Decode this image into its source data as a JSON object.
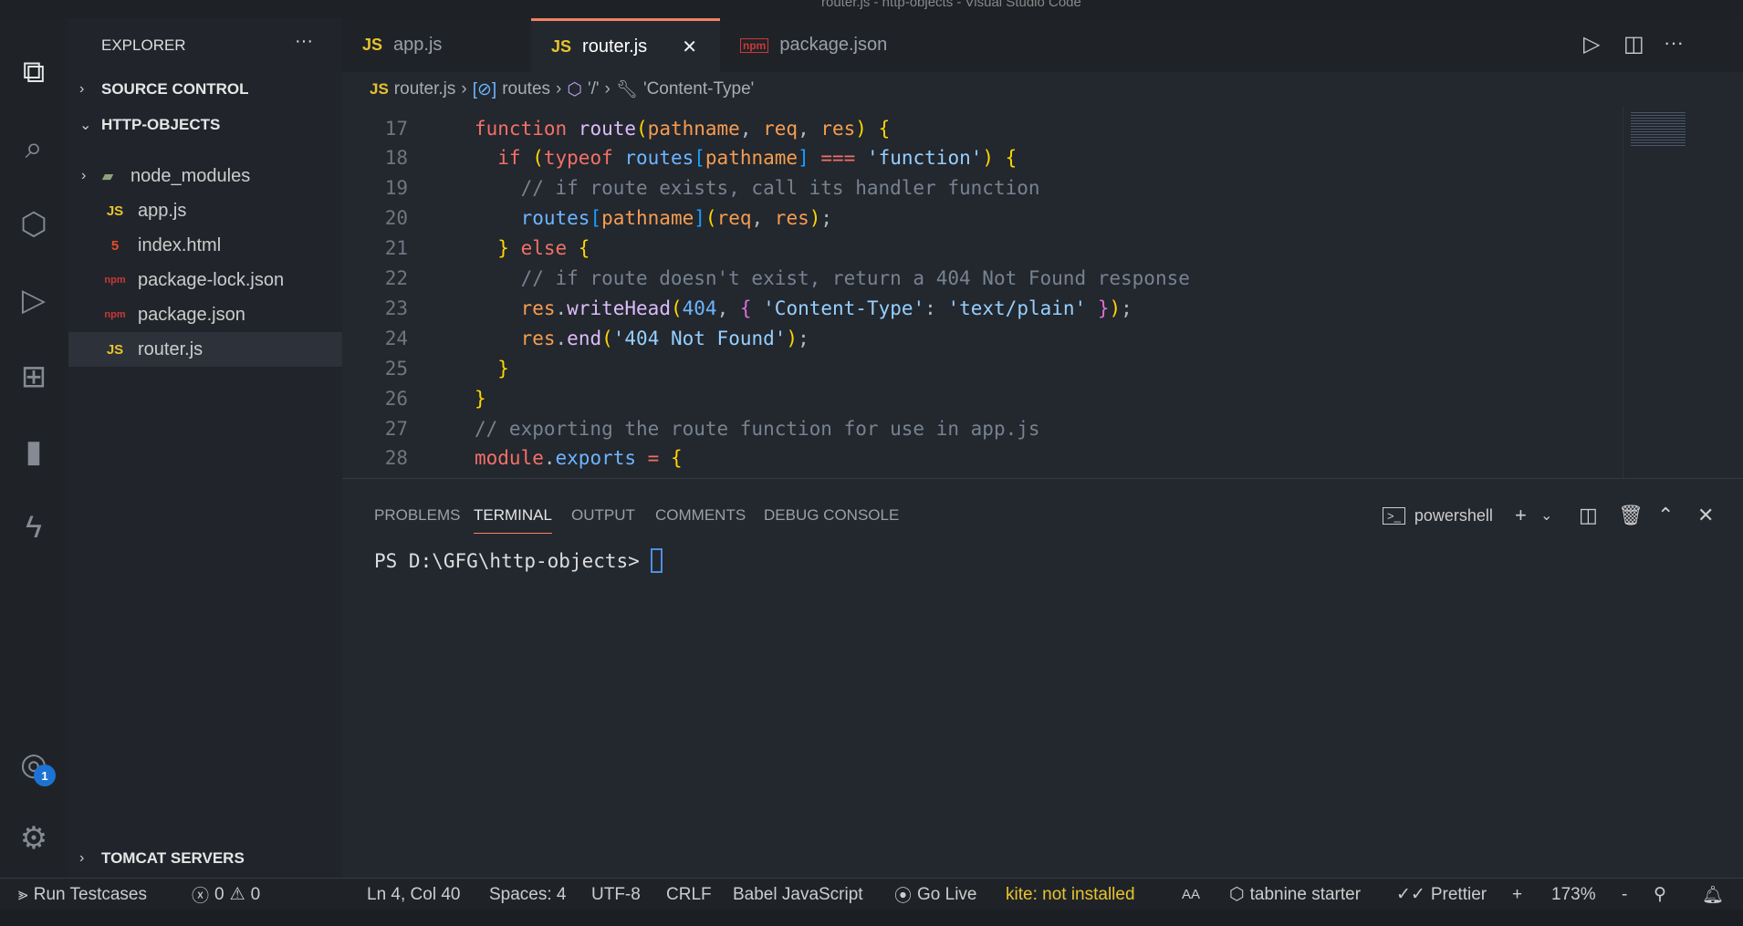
{
  "window": {
    "title": "router.js - http-objects - Visual Studio Code"
  },
  "activity_bar": {
    "items": [
      "files-icon",
      "search-icon",
      "source-control-icon",
      "run-debug-icon",
      "extensions-icon",
      "charts-icon",
      "lightning-icon"
    ],
    "account_badge": "1"
  },
  "sidebar": {
    "header": "EXPLORER",
    "more": "···",
    "sections": {
      "source_control": "SOURCE CONTROL",
      "project": "HTTP-OBJECTS",
      "tomcat": "TOMCAT SERVERS"
    },
    "files": [
      {
        "name": "node_modules",
        "icon": "folder",
        "badge": "",
        "folder": true
      },
      {
        "name": "app.js",
        "icon": "JS"
      },
      {
        "name": "index.html",
        "icon": "5"
      },
      {
        "name": "package-lock.json",
        "icon": "npm"
      },
      {
        "name": "package.json",
        "icon": "npm"
      },
      {
        "name": "router.js",
        "icon": "JS",
        "selected": true
      }
    ]
  },
  "tabs": [
    {
      "label": "app.js",
      "icon": "JS"
    },
    {
      "label": "router.js",
      "icon": "JS",
      "active": true,
      "close": "✕"
    },
    {
      "label": "package.json",
      "icon": "npm"
    }
  ],
  "breadcrumb": {
    "file": "router.js",
    "file_icon": "JS",
    "symbol1": "routes",
    "symbol2": "'/'",
    "symbol3": "'Content-Type'",
    "sep": "›"
  },
  "editor": {
    "lines": [
      {
        "n": "17",
        "t": [
          [
            "function ",
            "kw"
          ],
          [
            "route",
            "fn"
          ],
          [
            "(",
            "b1"
          ],
          [
            "pathname",
            "pa"
          ],
          [
            ", ",
            "pl"
          ],
          [
            "req",
            "pa"
          ],
          [
            ", ",
            "pl"
          ],
          [
            "res",
            "pa"
          ],
          [
            ") ",
            "b1"
          ],
          [
            "{",
            "b1"
          ]
        ]
      },
      {
        "n": "18",
        "t": [
          [
            "  if ",
            "kw"
          ],
          [
            "(",
            "b1"
          ],
          [
            "typeof ",
            "kw"
          ],
          [
            "routes",
            "va"
          ],
          [
            "[",
            "b3"
          ],
          [
            "pathname",
            "pa"
          ],
          [
            "] ",
            "b3"
          ],
          [
            "=== ",
            "kw"
          ],
          [
            "'function'",
            "st"
          ],
          [
            ") ",
            "b1"
          ],
          [
            "{",
            "b1"
          ]
        ]
      },
      {
        "n": "19",
        "t": [
          [
            "    // if route exists, call its handler function",
            "cm"
          ]
        ]
      },
      {
        "n": "20",
        "t": [
          [
            "    routes",
            "va"
          ],
          [
            "[",
            "b3"
          ],
          [
            "pathname",
            "pa"
          ],
          [
            "]",
            "b3"
          ],
          [
            "(",
            "b1"
          ],
          [
            "req",
            "pa"
          ],
          [
            ", ",
            "pl"
          ],
          [
            "res",
            "pa"
          ],
          [
            ")",
            "b1"
          ],
          [
            ";",
            "pl"
          ]
        ]
      },
      {
        "n": "21",
        "t": [
          [
            "  } ",
            "b1"
          ],
          [
            "else ",
            "kw"
          ],
          [
            "{",
            "b1"
          ]
        ]
      },
      {
        "n": "22",
        "t": [
          [
            "    // if route doesn't exist, return a 404 Not Found response",
            "cm"
          ]
        ]
      },
      {
        "n": "23",
        "t": [
          [
            "    res",
            "pa"
          ],
          [
            ".",
            "pl"
          ],
          [
            "writeHead",
            "fn"
          ],
          [
            "(",
            "b1"
          ],
          [
            "404",
            "nu"
          ],
          [
            ", ",
            "pl"
          ],
          [
            "{ ",
            "b2"
          ],
          [
            "'Content-Type'",
            "st"
          ],
          [
            ": ",
            "pl"
          ],
          [
            "'text/plain' ",
            "st"
          ],
          [
            "}",
            "b2"
          ],
          [
            ")",
            "b1"
          ],
          [
            ";",
            "pl"
          ]
        ]
      },
      {
        "n": "24",
        "t": [
          [
            "    res",
            "pa"
          ],
          [
            ".",
            "pl"
          ],
          [
            "end",
            "fn"
          ],
          [
            "(",
            "b1"
          ],
          [
            "'404 Not Found'",
            "st"
          ],
          [
            ")",
            "b1"
          ],
          [
            ";",
            "pl"
          ]
        ]
      },
      {
        "n": "25",
        "t": [
          [
            "  }",
            "b1"
          ]
        ]
      },
      {
        "n": "26",
        "t": [
          [
            "}",
            "b1"
          ]
        ]
      },
      {
        "n": "27",
        "t": [
          [
            "// exporting the route function for use in app.js",
            "cm"
          ]
        ]
      },
      {
        "n": "28",
        "t": [
          [
            "module",
            "kw"
          ],
          [
            ".",
            "pl"
          ],
          [
            "exports ",
            "va"
          ],
          [
            "= ",
            "kw"
          ],
          [
            "{",
            "b1"
          ]
        ]
      }
    ]
  },
  "panel": {
    "tabs": [
      "PROBLEMS",
      "TERMINAL",
      "OUTPUT",
      "COMMENTS",
      "DEBUG CONSOLE"
    ],
    "active_tab": "TERMINAL",
    "shell": "powershell",
    "prompt": "PS D:\\GFG\\http-objects>"
  },
  "status": {
    "run": "Run Testcases",
    "errors": "0",
    "warnings": "0",
    "position": "Ln 4, Col 40",
    "spaces": "Spaces: 4",
    "encoding": "UTF-8",
    "eol": "CRLF",
    "language": "Babel JavaScript",
    "golive": "Go Live",
    "kite": "kite: not installed",
    "aa": "AA",
    "tabnine": "tabnine starter",
    "prettier": "Prettier",
    "plus": "+",
    "zoom": "173%",
    "minus": "-"
  },
  "colors": {
    "accent": "#f38262",
    "kite": "#e8c32e",
    "badge": "#1d73d4"
  }
}
